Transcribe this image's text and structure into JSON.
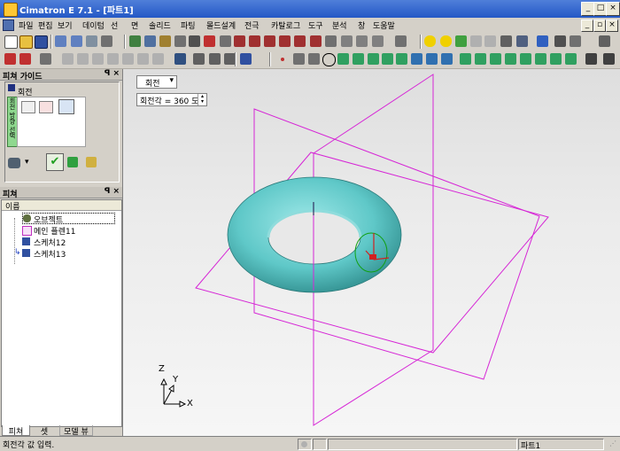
{
  "window": {
    "title": "Cimatron E 7.1 - [파트1]"
  },
  "menu": [
    "파일",
    "편집",
    "보기",
    "데이텀",
    "선",
    "면",
    "솔리드",
    "파팅",
    "몰드설계",
    "전극",
    "카탈로그",
    "도구",
    "분석",
    "창",
    "도움말"
  ],
  "feature_guide": {
    "header": "피쳐 가이드",
    "close_glyph": "ꟼ ×",
    "step_label": "회전",
    "side_tab": "회전 방향 선택"
  },
  "feature_tree": {
    "header": "피쳐",
    "column": "이름",
    "items": [
      "오브젝트",
      "메인 플렌11",
      "스케처12",
      "스케처13"
    ]
  },
  "bottom_tabs": [
    "피쳐",
    "셋",
    "모델 뷰"
  ],
  "viewport": {
    "dropdown": "회전",
    "angle_field": "회전각 = 360 도",
    "axis_x": "X",
    "axis_y": "Y",
    "axis_z": "Z",
    "colors": {
      "torus": "#5fc8c8",
      "planes": "#d626d6",
      "bg": "#ececec"
    }
  },
  "status": {
    "message": "회전각 값 입력.",
    "part": "파트1"
  }
}
